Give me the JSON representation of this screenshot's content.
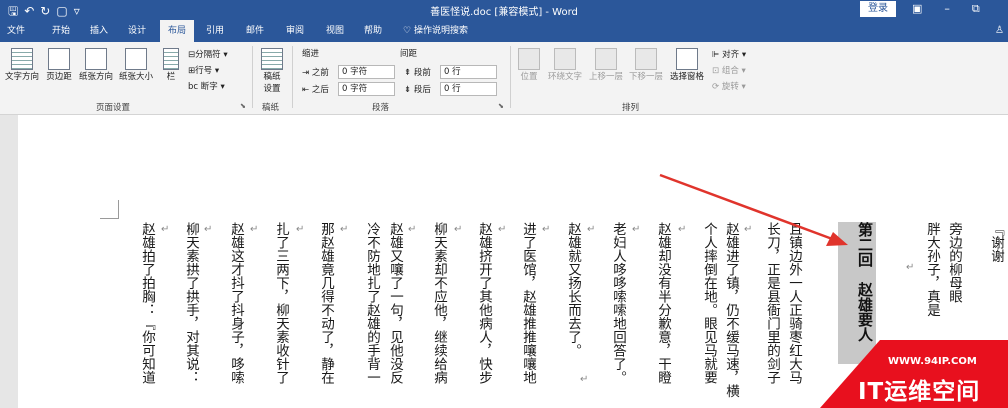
{
  "title_bar": {
    "qat_icons": [
      "save-icon",
      "undo-icon",
      "redo-icon",
      "new-doc-icon",
      "customize-icon"
    ],
    "document_title": "善医怪说.doc [兼容模式] - Word",
    "login_label": "登录",
    "window_controls": [
      "ribbon-display-icon",
      "minimize-icon",
      "restore-icon"
    ]
  },
  "tabs": [
    "文件",
    "开始",
    "插入",
    "设计",
    "布局",
    "引用",
    "邮件",
    "审阅",
    "视图",
    "帮助"
  ],
  "active_tab": "布局",
  "tell_me": "操作说明搜索",
  "ribbon": {
    "page_setup": {
      "buttons": [
        "文字方向",
        "页边距",
        "纸张方向",
        "纸张大小",
        "栏"
      ],
      "small_buttons": [
        "分隔符",
        "行号",
        "断字"
      ],
      "group_label": "页面设置"
    },
    "manuscript": {
      "button": "稿纸设置",
      "button_line1": "稿纸",
      "button_line2": "设置",
      "group_label": "稿纸"
    },
    "paragraph": {
      "indent_label": "缩进",
      "spacing_label": "间距",
      "indent_before_label": "之前",
      "indent_before_value": "0 字符",
      "indent_after_label": "之后",
      "indent_after_value": "0 字符",
      "spacing_before_label": "段前",
      "spacing_before_value": "0 行",
      "spacing_after_label": "段后",
      "spacing_after_value": "0 行",
      "group_label": "段落"
    },
    "arrange": {
      "buttons": [
        "位置",
        "环绕文字",
        "上移一层",
        "下移一层",
        "选择窗格"
      ],
      "small_buttons": [
        "对齐",
        "组合",
        "旋转"
      ],
      "group_label": "排列"
    }
  },
  "document": {
    "heading": "第二回　赵雄要人",
    "columns": [
      "旁边的柳母眼",
      "胖大孙子，真是",
      "且镇边外一人正骑枣红大马",
      "长刀，正是县衙门里的剑子",
      "赵雄进了镇，仍不缓马速，横",
      "个人摔倒在地。眼见马就要",
      "赵雄却没有半分歉意，干瞪",
      "老妇人哆哆嗦嗦地回答了。",
      "赵雄就又扬长而去了。",
      "进了医馆，赵雄推推嚷嚷地",
      "赵雄挤开了其他病人，快步",
      "柳天素却不应他，继续给病",
      "赵雄又嚷了一句，见他没反",
      "冷不防地扎了赵雄的手背一",
      "那赵雄竟几得不动了，静在",
      "扎了三两下，柳天素收针了",
      "赵雄这才抖了抖身子，哆嗦",
      "柳天素拱了拱手，对其说：",
      "赵雄拍了拍胸：『你可知道"
    ],
    "right_edge_text": "『谢谢"
  },
  "watermark": {
    "url": "WWW.94IP.COM",
    "text": "IT运维空间"
  },
  "colors": {
    "word_blue": "#2b579a",
    "arrow_red": "#e0342c",
    "watermark_red": "#e8101e"
  }
}
